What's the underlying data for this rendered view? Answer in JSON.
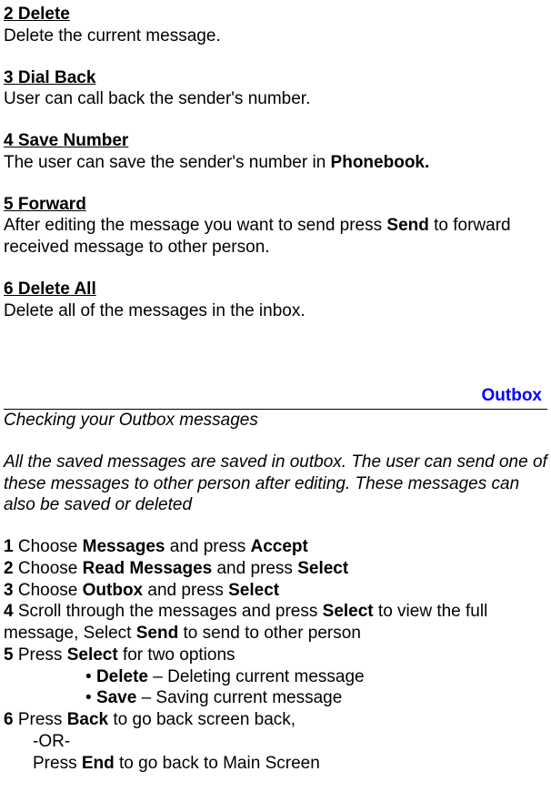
{
  "sections": [
    {
      "heading": "2 Delete",
      "body": "Delete the current message."
    },
    {
      "heading": "3 Dial Back",
      "body": "User can call back the sender's number."
    },
    {
      "heading": "4 Save Number",
      "body_pre": "The user can save the sender's number in ",
      "body_bold": "Phonebook."
    },
    {
      "heading": "5 Forward",
      "body_pre": "After editing the message you want to send press ",
      "body_bold": "Send",
      "body_post": " to forward received message to other person."
    },
    {
      "heading": "6 Delete All",
      "body": "Delete all of the messages in the inbox."
    }
  ],
  "section_title": "Outbox",
  "intro_title": "Checking your Outbox messages",
  "intro_body": "All the saved messages are saved in outbox.  The user can send one of these messages to other person after editing. These messages can also be saved or deleted",
  "steps": {
    "s1": {
      "num": "1",
      "pre": " Choose ",
      "b1": "Messages",
      "mid": " and press ",
      "b2": "Accept"
    },
    "s2": {
      "num": "2",
      "pre": " Choose ",
      "b1": "Read Messages",
      "mid": " and press ",
      "b2": "Select"
    },
    "s3": {
      "num": "3",
      "pre": " Choose ",
      "b1": "Outbox",
      "mid": " and press ",
      "b2": "Select"
    },
    "s4": {
      "num": "4",
      "pre": " Scroll through the messages and press ",
      "b1": "Select",
      "mid": " to view the full message, Select ",
      "b2": "Send",
      "post": " to send to other person"
    },
    "s5": {
      "num": "5",
      "pre": " Press ",
      "b1": "Select",
      "post": " for two options"
    },
    "bullet1": {
      "marker": "•",
      "space": " ",
      "b": "Delete",
      "rest": " – Deleting current message"
    },
    "bullet2": {
      "marker": "•",
      "space": " ",
      "b": "Save",
      "rest": " – Saving current message"
    },
    "s6": {
      "num": "6",
      "pre": " Press ",
      "b1": "Back",
      "post": " to go back screen back,"
    },
    "or": "-OR-",
    "end_pre": "Press ",
    "end_b": "End",
    "end_post": " to go back to Main Screen"
  }
}
